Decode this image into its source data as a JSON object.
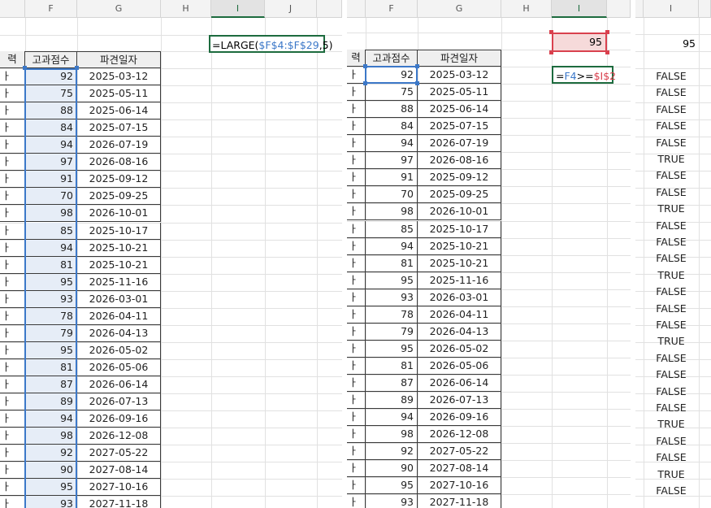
{
  "columns": {
    "p1": [
      "F",
      "G",
      "H",
      "I",
      "J"
    ],
    "p2": [
      "F",
      "G",
      "H",
      "I"
    ],
    "p3": [
      "I"
    ]
  },
  "table": {
    "truncated_header": "력",
    "truncated_cell": "ㅏ",
    "headers": [
      "고과점수",
      "파견일자"
    ],
    "scores": [
      "92",
      "75",
      "88",
      "84",
      "94",
      "97",
      "91",
      "70",
      "98",
      "85",
      "94",
      "81",
      "95",
      "93",
      "78",
      "79",
      "95",
      "81",
      "87",
      "89",
      "94",
      "98",
      "92",
      "90",
      "95",
      "93"
    ],
    "dates": [
      "2025-03-12",
      "2025-05-11",
      "2025-06-14",
      "2025-07-15",
      "2026-07-19",
      "2026-08-16",
      "2025-09-12",
      "2025-09-25",
      "2026-10-01",
      "2025-10-17",
      "2025-10-21",
      "2025-10-21",
      "2025-11-16",
      "2026-03-01",
      "2026-04-11",
      "2026-04-13",
      "2026-05-02",
      "2026-05-06",
      "2026-06-14",
      "2026-07-13",
      "2026-09-16",
      "2026-12-08",
      "2027-05-22",
      "2027-08-14",
      "2027-10-16",
      "2027-11-18"
    ]
  },
  "panel1": {
    "formula_prefix": "=LARGE(",
    "formula_ref": "$F$4:$F$29",
    "formula_suffix": ",5)"
  },
  "panel2": {
    "i2_value": "95",
    "formula_eq": "=",
    "formula_ref1": "F4",
    "formula_op": ">=",
    "formula_ref2": "$I$2"
  },
  "panel3": {
    "i2_value": "95",
    "results": [
      "FALSE",
      "FALSE",
      "FALSE",
      "FALSE",
      "FALSE",
      "TRUE",
      "FALSE",
      "FALSE",
      "TRUE",
      "FALSE",
      "FALSE",
      "FALSE",
      "TRUE",
      "FALSE",
      "FALSE",
      "FALSE",
      "TRUE",
      "FALSE",
      "FALSE",
      "FALSE",
      "FALSE",
      "TRUE",
      "FALSE",
      "FALSE",
      "TRUE",
      "FALSE"
    ]
  }
}
